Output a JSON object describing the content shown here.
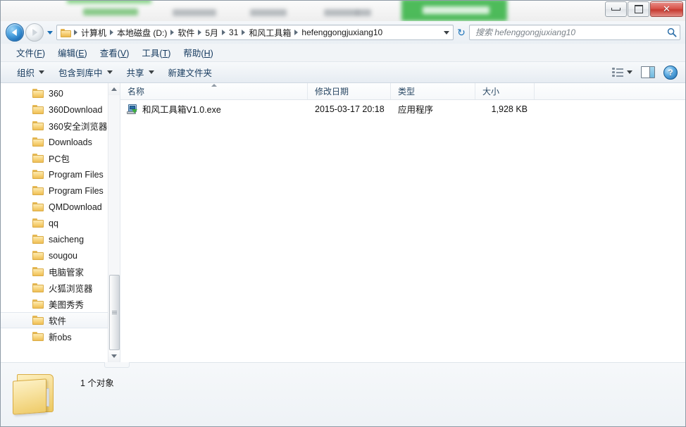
{
  "window": {
    "controls": {
      "minimize": "–",
      "maximize": "□",
      "close": "✕"
    },
    "background_note": "blurred webpage behind window"
  },
  "address_bar": {
    "back_tooltip": "后退",
    "forward_tooltip": "前进",
    "history_tooltip": "最近浏览的位置",
    "breadcrumbs": [
      "计算机",
      "本地磁盘 (D:)",
      "软件",
      "5月",
      "31",
      "和风工具箱",
      "hefenggongjuxiang10"
    ],
    "refresh_icon": "↻",
    "dropdown_icon": "chevron-down-icon"
  },
  "search": {
    "placeholder": "搜索 hefenggongjuxiang10",
    "value": "",
    "icon": "search-icon"
  },
  "menu": {
    "items": [
      {
        "label": "文件",
        "accel": "F"
      },
      {
        "label": "编辑",
        "accel": "E"
      },
      {
        "label": "查看",
        "accel": "V"
      },
      {
        "label": "工具",
        "accel": "T"
      },
      {
        "label": "帮助",
        "accel": "H"
      }
    ]
  },
  "toolbar": {
    "organize": "组织",
    "include_in_library": "包含到库中",
    "share": "共享",
    "new_folder": "新建文件夹",
    "view_icon": "list-view-icon",
    "preview_pane_icon": "preview-pane-icon",
    "help_icon": "help-icon",
    "help_glyph": "?"
  },
  "sidebar": {
    "items": [
      {
        "label": "360"
      },
      {
        "label": "360Download"
      },
      {
        "label": "360安全浏览器"
      },
      {
        "label": "Downloads"
      },
      {
        "label": "PC包"
      },
      {
        "label": "Program Files"
      },
      {
        "label": "Program Files"
      },
      {
        "label": "QMDownload"
      },
      {
        "label": "qq"
      },
      {
        "label": "saicheng"
      },
      {
        "label": "sougou"
      },
      {
        "label": "电脑管家"
      },
      {
        "label": "火狐浏览器"
      },
      {
        "label": "美图秀秀"
      },
      {
        "label": "软件",
        "selected": true
      },
      {
        "label": "新obs"
      }
    ]
  },
  "file_list": {
    "columns": [
      {
        "label": "名称",
        "sorted": "asc"
      },
      {
        "label": "修改日期"
      },
      {
        "label": "类型"
      },
      {
        "label": "大小"
      }
    ],
    "rows": [
      {
        "icon": "executable-icon",
        "name": "和风工具箱V1.0.exe",
        "modified": "2015-03-17 20:18",
        "type": "应用程序",
        "size": "1,928 KB"
      }
    ]
  },
  "status_bar": {
    "text": "1 个对象",
    "folder_icon": "folder-icon"
  },
  "colors": {
    "accent": "#1d6fb8",
    "folder_yellow": "#f7d17a",
    "close_red": "#c63a30",
    "bg_green": "#3cb54a"
  }
}
